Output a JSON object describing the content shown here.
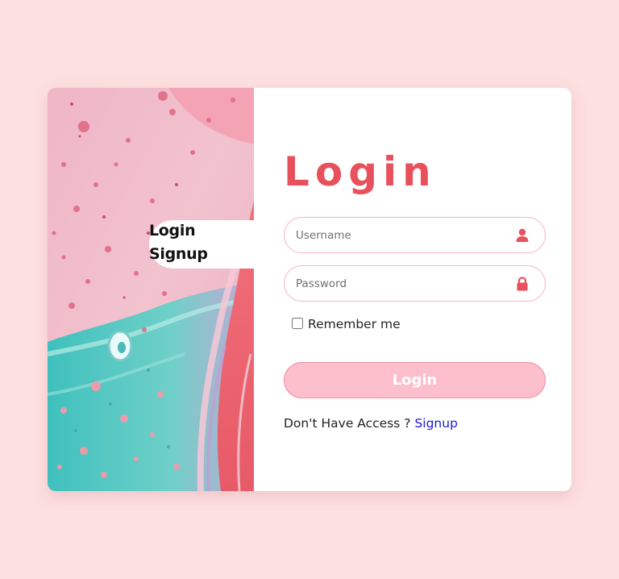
{
  "switcher": {
    "login_label": "Login",
    "signup_label": "Signup"
  },
  "form": {
    "title": "Login",
    "username": {
      "placeholder": "Username",
      "value": "",
      "icon": "user-icon"
    },
    "password": {
      "placeholder": "Password",
      "value": "",
      "icon": "lock-icon"
    },
    "remember_label": "Remember me",
    "remember_checked": false,
    "submit_label": "Login"
  },
  "footer": {
    "prompt": "Don't Have Access ?",
    "signup_link": "Signup"
  },
  "colors": {
    "page_background": "#fde0e0",
    "accent": "#e8505b",
    "button_fill": "#fdbfcc",
    "field_border": "#f6b6c4",
    "link": "#1a1adb"
  }
}
